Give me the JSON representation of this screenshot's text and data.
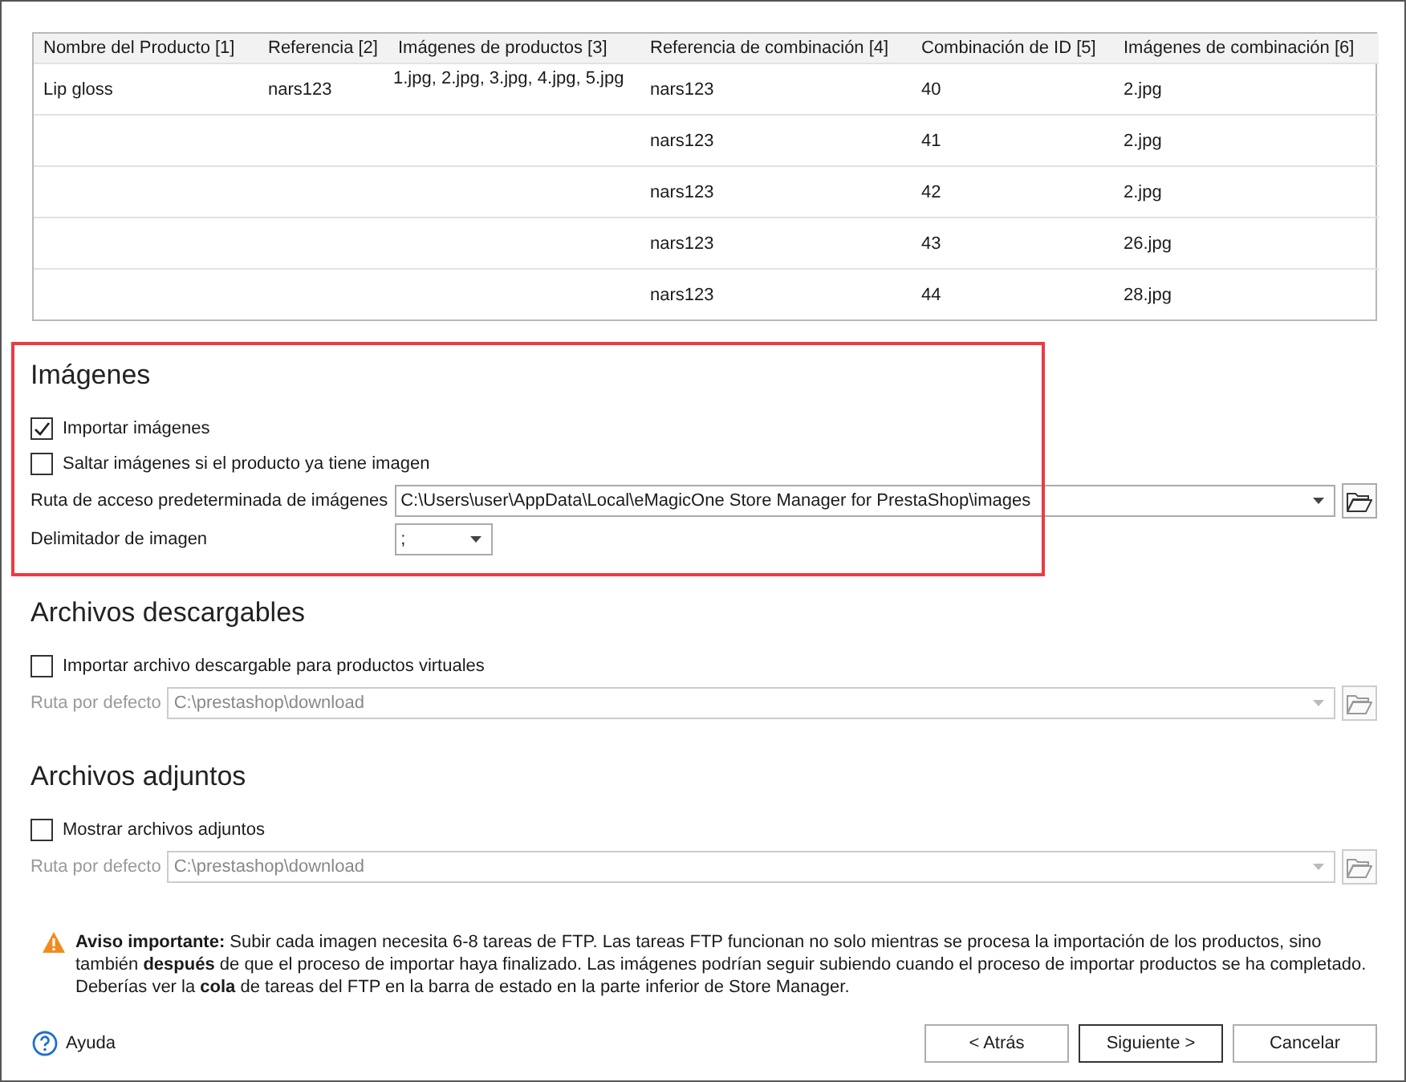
{
  "table": {
    "columns": [
      "Nombre del Producto [1]",
      "Referencia [2]",
      "Imágenes de productos [3]",
      "Referencia de combinación [4]",
      "Combinación de ID [5]",
      "Imágenes de combinación [6]"
    ],
    "rows": [
      [
        "Lip gloss",
        "nars123",
        "1.jpg, 2.jpg, 3.jpg, 4.jpg, 5.jpg",
        "nars123",
        "40",
        "2.jpg"
      ],
      [
        null,
        null,
        null,
        "nars123",
        "41",
        "2.jpg"
      ],
      [
        null,
        null,
        null,
        "nars123",
        "42",
        "2.jpg"
      ],
      [
        null,
        null,
        null,
        "nars123",
        "43",
        "26.jpg"
      ],
      [
        null,
        null,
        null,
        "nars123",
        "44",
        "28.jpg"
      ]
    ]
  },
  "sections": [
    {
      "title": "Imágenes",
      "highlighted": true,
      "options": [
        {
          "label": "Importar imágenes",
          "checked": true
        },
        {
          "label": "Saltar imágenes si el producto ya tiene imagen",
          "checked": false
        }
      ],
      "fields": [
        {
          "kind": "path",
          "label": "Ruta de acceso predeterminada de imágenes",
          "value": "C:\\Users\\user\\AppData\\Local\\eMagicOne Store Manager for PrestaShop\\images",
          "disabled": false
        },
        {
          "kind": "dropdown",
          "label": "Delimitador de imagen",
          "value": ";",
          "disabled": false
        }
      ]
    },
    {
      "title": "Archivos descargables",
      "options": [
        {
          "label": "Importar archivo descargable para productos virtuales",
          "checked": false
        }
      ],
      "fields": [
        {
          "kind": "path",
          "label": "Ruta por defecto",
          "value": "C:\\prestashop\\download",
          "disabled": true
        }
      ]
    },
    {
      "title": "Archivos adjuntos",
      "options": [
        {
          "label": "Mostrar archivos adjuntos",
          "checked": false
        }
      ],
      "fields": [
        {
          "kind": "path",
          "label": "Ruta por defecto",
          "value": "C:\\prestashop\\download",
          "disabled": true
        }
      ]
    }
  ],
  "notice": {
    "text": "**Aviso importante:** Subir cada imagen necesita 6-8 tareas de FTP. Las tareas FTP funcionan no solo mientras se procesa la importación de los productos, sino también **después** de que el proceso de importar haya finalizado. Las imágenes podrían seguir subiendo cuando el proceso de importar productos se ha completado. Deberías ver la **cola** de tareas del FTP en la barra de estado en la parte inferior de Store Manager."
  },
  "footer": {
    "help": "Ayuda",
    "buttons": [
      {
        "label": "< Atrás",
        "default": false
      },
      {
        "label": "Siguiente >",
        "default": true
      },
      {
        "label": "Cancelar",
        "default": false
      }
    ]
  }
}
